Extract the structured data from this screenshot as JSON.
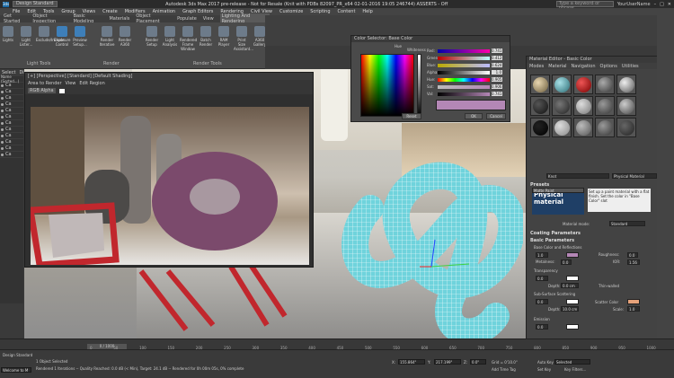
{
  "titlebar": {
    "app_icon": "3ds",
    "workspace": "Design Standard",
    "title": "Autodesk 3ds Max 2017 pre-release - Not for Resale (Knit with PDBs 82097_PR_x64 02-01-2016 19:05 246744) ASSERTS - Off",
    "search_placeholder": "Type a keyword or phrase",
    "user": "YourUserName",
    "win_min": "–",
    "win_max": "□",
    "win_close": "✕"
  },
  "menubar": [
    "File",
    "Edit",
    "Tools",
    "Group",
    "Views",
    "Create",
    "Modifiers",
    "Animation",
    "Graph Editors",
    "Rendering",
    "Civil View",
    "Customize",
    "Scripting",
    "Content",
    "Help"
  ],
  "ribbon_tabs": [
    "Get Started",
    "Object Inspection",
    "Basic Modeling",
    "Materials",
    "Object Placement",
    "Populate",
    "View",
    "Lighting And Rendering"
  ],
  "ribbon": {
    "buttons": [
      "Lights",
      "Light Lister...",
      "Exclude/Include",
      "Exposure Control",
      "Preview Setup...",
      "Render Iterative",
      "Render A360",
      "Render Setup",
      "Light Analysis",
      "Rendered Frame Window",
      "Batch Render",
      "RAM Player",
      "Print Size Assistant...",
      "A360 Gallery"
    ],
    "groups": [
      "Light Tools",
      "Render",
      "Render Tools"
    ]
  },
  "left": {
    "tabs": [
      "Select",
      "Display",
      "Edit",
      "Customize"
    ],
    "header": "Name (Sorted...)",
    "items": [
      "Ca",
      "Ca",
      "Ca",
      "Ca",
      "Ca",
      "Ca",
      "Ca",
      "Ca",
      "Ca",
      "Ca",
      "Ca",
      "Ca"
    ]
  },
  "renderwin": {
    "title": "[+] [Perspective] [Standard] [Default Shading]",
    "toolbar": [
      "Area to Render",
      "View",
      "Edit Region",
      "RGB Alpha"
    ]
  },
  "colorsel": {
    "title": "Color Selector: Base Color",
    "hue_label": "Hue",
    "whiteness_label": "Whiteness",
    "blackness_label": "Blackness",
    "rows": [
      {
        "label": "Red:",
        "value": "0.741"
      },
      {
        "label": "Green:",
        "value": "0.412"
      },
      {
        "label": "Blue:",
        "value": "0.624"
      },
      {
        "label": "Alpha:",
        "value": "1.0"
      },
      {
        "label": "Hue:",
        "value": "0.905"
      },
      {
        "label": "Sat:",
        "value": "0.906"
      },
      {
        "label": "Val:",
        "value": "0.741"
      }
    ],
    "reset": "Reset",
    "ok": "OK",
    "cancel": "Cancel"
  },
  "mated": {
    "title": "Material Editor - Basic Color",
    "menu": [
      "Modes",
      "Material",
      "Navigation",
      "Options",
      "Utilities"
    ],
    "material_name": "Knot",
    "material_type": "Physical Material",
    "presets_label": "Presets",
    "preset_value": "Matte Paint",
    "preset_note": "Set up a paint material with a flat finish. Set the color in \"Base Color\" slot",
    "material_mode_label": "Material mode:",
    "material_mode": "Standard",
    "coating": "Coating Parameters",
    "basic": "Basic Parameters",
    "base_color": "Base Color and Reflections",
    "weight": "1.0",
    "roughness_label": "Roughness:",
    "roughness": "0.0",
    "metalness_label": "Metalness:",
    "metalness": "0.0",
    "ior_label": "IOR:",
    "ior": "1.56",
    "transparency": "Transparency",
    "trans_weight": "0.0",
    "depth_label": "Depth:",
    "depth": "0.0 cm",
    "thin_walled": "Thin-walled",
    "sss": "Sub-Surface Scattering",
    "sss_weight": "0.0",
    "scatter_label": "Scatter Color",
    "sss_depth": "10.0 cm",
    "scale_label": "Scale:",
    "scale": "1.0",
    "emission": "Emission",
    "emission_weight": "0.0",
    "colors": {
      "base": "#b487b6",
      "scatter": "#e6a27a",
      "white": "#ffffff"
    }
  },
  "timeline": {
    "frame": "0 / 1000",
    "ticks": [
      "0",
      "50",
      "100",
      "150",
      "200",
      "250",
      "300",
      "350",
      "400",
      "450",
      "500",
      "550",
      "600",
      "650",
      "700",
      "750",
      "800",
      "850",
      "900",
      "950",
      "1000"
    ]
  },
  "status": {
    "workspace": "Design Standard",
    "objects": "1 Object Selected",
    "msg": "Rendered 1 Iterations -- Quality Reached: 0.0 dB (< Min), Target: 24.1 dB -- Rendered for 0h 00m 05s, 0% complete",
    "maxscript": "Welcome to M",
    "x_label": "X:",
    "x": "155.864\"",
    "y_label": "Y:",
    "y": "217.199\"",
    "z_label": "Z:",
    "z": "0.0\"",
    "grid": "Grid = 0'10.0\"",
    "addtime": "Add Time Tag",
    "autokey": "Auto Key",
    "setkey": "Set Key",
    "selected": "Selected",
    "keyfilters": "Key Filters..."
  },
  "colors": {
    "knot_cyan": "#6fd3dc",
    "knot_purple": "#7b4a6c",
    "glasses_red": "#c1272d"
  }
}
